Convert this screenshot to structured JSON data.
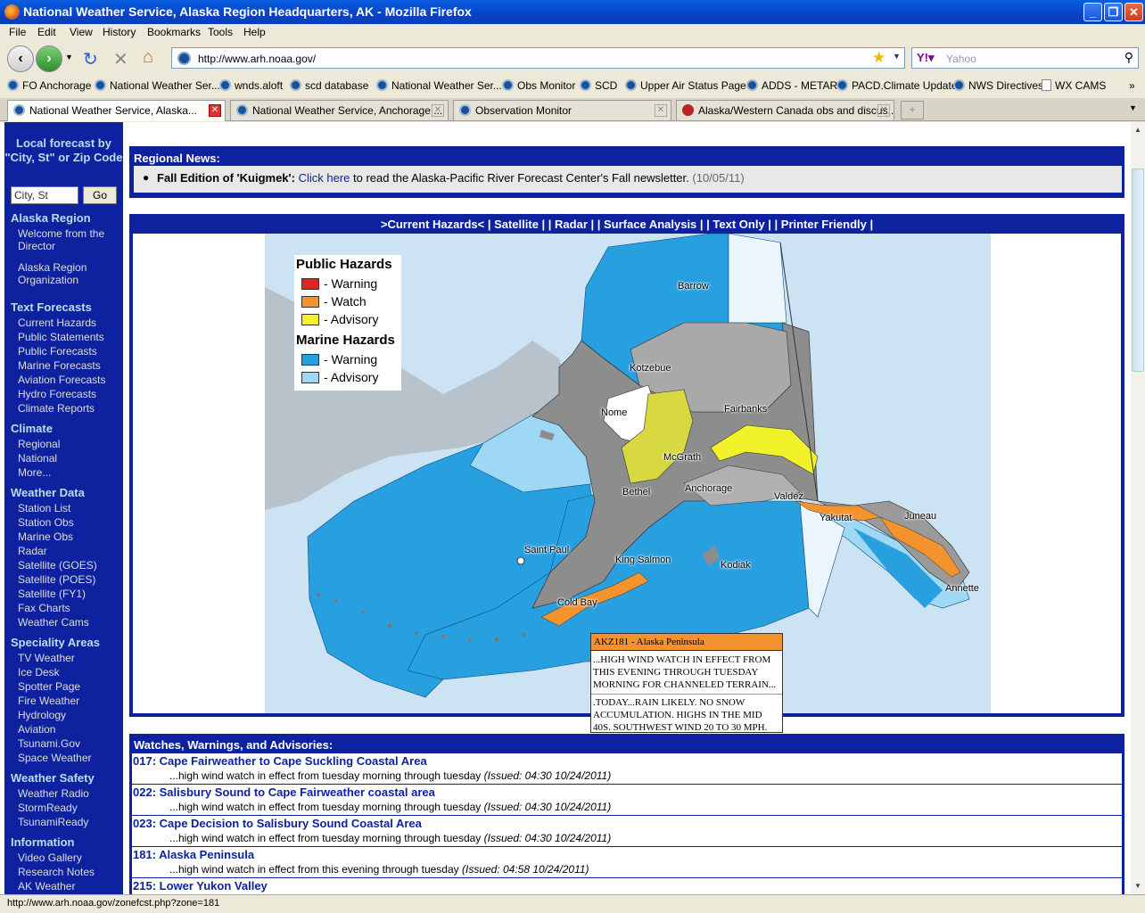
{
  "window": {
    "title": "National Weather Service, Alaska Region Headquarters, AK - Mozilla Firefox"
  },
  "menu": [
    "File",
    "Edit",
    "View",
    "History",
    "Bookmarks",
    "Tools",
    "Help"
  ],
  "address": {
    "url": "http://www.arh.noaa.gov/",
    "search_placeholder": "Yahoo"
  },
  "bookmarks": [
    "FO Anchorage",
    "National Weather Ser...",
    "wnds.aloft",
    "scd database",
    "National Weather Ser...",
    "Obs Monitor",
    "SCD",
    "Upper Air Status Page",
    "ADDS - METARs",
    "PACD.Climate Update",
    "NWS Directives",
    "WX CAMS"
  ],
  "tabs": [
    {
      "label": "National Weather Service, Alaska..."
    },
    {
      "label": "National Weather Service, Anchorage ..."
    },
    {
      "label": "Observation Monitor"
    },
    {
      "label": "Alaska/Western Canada obs and discus..."
    }
  ],
  "sidebar": {
    "local_forecast": "Local forecast by \"City, St\" or Zip Code",
    "city_placeholder": "City, St",
    "go": "Go",
    "sections": [
      {
        "title": "Alaska Region",
        "items": [
          "Welcome from the Director",
          "Alaska Region Organization"
        ]
      },
      {
        "title": "Text Forecasts",
        "items": [
          "Current Hazards",
          "Public Statements",
          "Public Forecasts",
          "Marine Forecasts",
          "Aviation Forecasts",
          "Hydro Forecasts",
          "Climate Reports"
        ]
      },
      {
        "title": "Climate",
        "items": [
          "Regional",
          "National",
          "More..."
        ]
      },
      {
        "title": "Weather Data",
        "items": [
          "Station List",
          "Station Obs",
          "Marine Obs",
          "Radar",
          "Satellite (GOES)",
          "Satellite (POES)",
          "Satellite (FY1)",
          "Fax Charts",
          "Weather Cams"
        ]
      },
      {
        "title": "Speciality Areas",
        "items": [
          "TV Weather",
          "Ice Desk",
          "Spotter Page",
          "Fire Weather",
          "Hydrology",
          "Aviation",
          "Tsunami.Gov",
          "Space Weather"
        ]
      },
      {
        "title": "Weather Safety",
        "items": [
          "Weather Radio",
          "StormReady",
          "TsunamiReady"
        ]
      },
      {
        "title": "Information",
        "items": [
          "Video Gallery",
          "Research Notes",
          "AK Weather Information Line"
        ]
      }
    ]
  },
  "news": {
    "heading": "Regional News:",
    "item_title": "Fall Edition of 'Kuigmek':",
    "item_link": "Click here",
    "item_text": "to read the Alaska-Pacific River Forecast Center's Fall newsletter.",
    "item_date": "(10/05/11)"
  },
  "map_links": ">Current Hazards< | Satellite | | Radar | | Surface Analysis | | Text Only | | Printer Friendly |",
  "legend": {
    "public_title": "Public Hazards",
    "public": [
      {
        "label": "- Warning",
        "color": "#e02424"
      },
      {
        "label": "- Watch",
        "color": "#f4922d"
      },
      {
        "label": "- Advisory",
        "color": "#f2f22a"
      }
    ],
    "marine_title": "Marine Hazards",
    "marine": [
      {
        "label": "- Warning",
        "color": "#28a0e0"
      },
      {
        "label": "- Advisory",
        "color": "#9ed8f5"
      }
    ]
  },
  "places": [
    "Barrow",
    "Kotzebue",
    "Nome",
    "Fairbanks",
    "McGrath",
    "Bethel",
    "Anchorage",
    "Valdez",
    "Yakutat",
    "Juneau",
    "Saint Paul",
    "King Salmon",
    "Kodiak",
    "Cold Bay",
    "Annette"
  ],
  "popup": {
    "header": "AKZ181 - Alaska Peninsula",
    "p1": "...HIGH WIND WATCH IN EFFECT FROM THIS EVENING THROUGH TUESDAY MORNING FOR CHANNELED TERRAIN...",
    "p2": ".TODAY...RAIN LIKELY. NO SNOW ACCUMULATION. HIGHS IN THE MID 40S. SOUTHWEST WIND 20 TO 30 MPH."
  },
  "wwa": {
    "heading": "Watches, Warnings, and Advisories:",
    "rows": [
      {
        "area": "017: Cape Fairweather to Cape Suckling Coastal Area",
        "text": "...high wind watch in effect from tuesday morning through tuesday",
        "issued": "(Issued: 04:30 10/24/2011)"
      },
      {
        "area": "022: Salisbury Sound to Cape Fairweather coastal area",
        "text": "...high wind watch in effect from tuesday morning through tuesday",
        "issued": "(Issued: 04:30 10/24/2011)"
      },
      {
        "area": "023: Cape Decision to Salisbury Sound Coastal Area",
        "text": "...high wind watch in effect from tuesday morning through tuesday",
        "issued": "(Issued: 04:30 10/24/2011)"
      },
      {
        "area": "181: Alaska Peninsula",
        "text": "...high wind watch in effect from this evening through tuesday",
        "issued": "(Issued: 04:58 10/24/2011)"
      },
      {
        "area": "215: Lower Yukon Valley",
        "text": "",
        "issued": ""
      }
    ]
  },
  "status": "http://www.arh.noaa.gov/zonefcst.php?zone=181"
}
